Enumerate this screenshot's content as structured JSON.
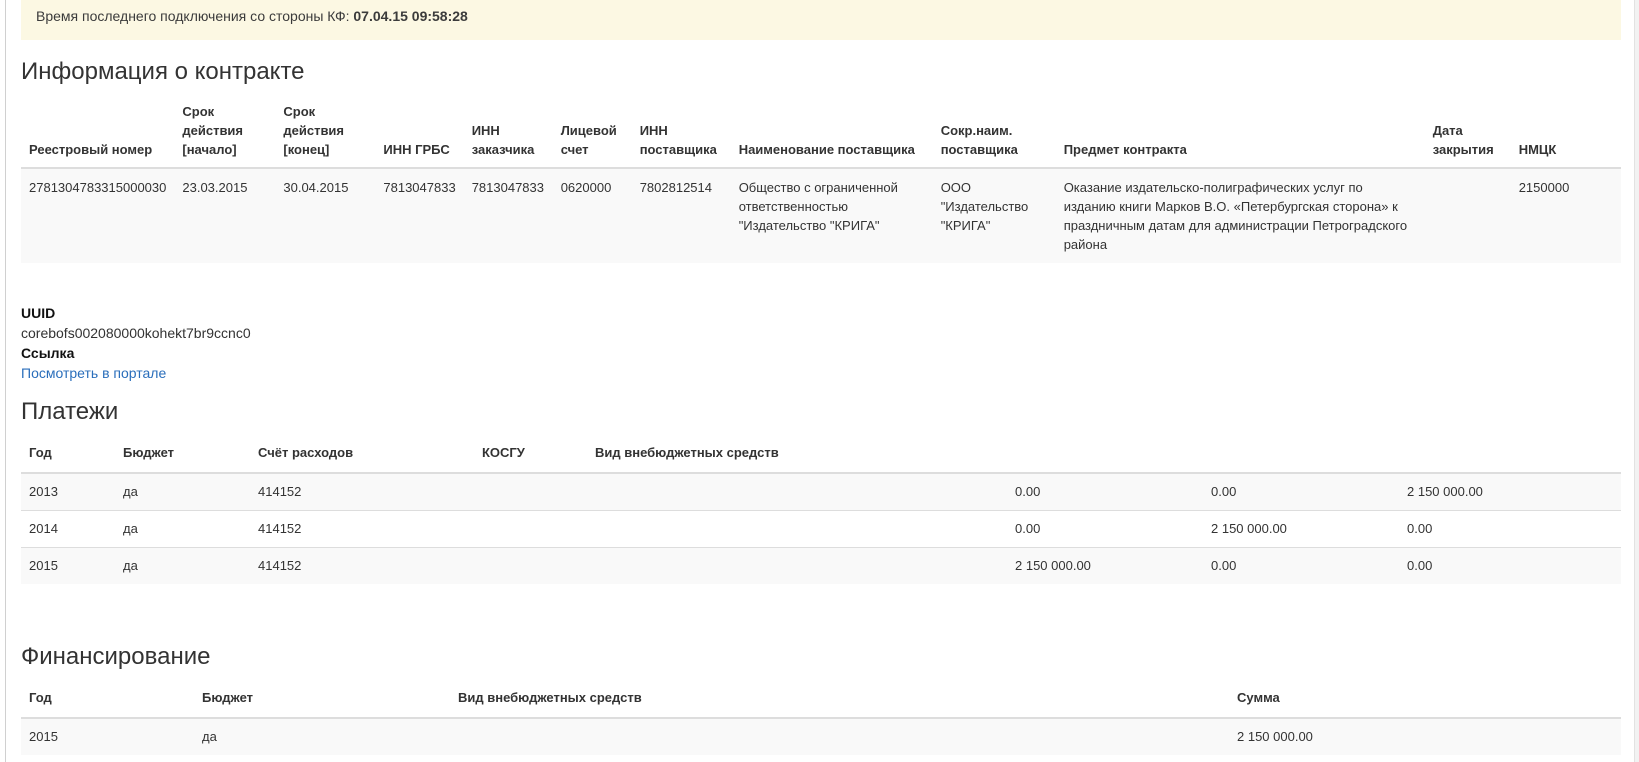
{
  "alert": {
    "label": "Время последнего подключения со стороны КФ:",
    "value": "07.04.15 09:58:28"
  },
  "contract": {
    "title": "Информация о контракте",
    "headers": [
      "Реестровый номер",
      "Срок действия [начало]",
      "Срок действия [конец]",
      "ИНН ГРБС",
      "ИНН заказчика",
      "Лицевой счет",
      "ИНН поставщика",
      "Наименование поставщика",
      "Сокр.наим. поставщика",
      "Предмет контракта",
      "Дата закрытия",
      "НМЦК"
    ],
    "row": {
      "reg_number": "2781304783315000030",
      "start": "23.03.2015",
      "end": "30.04.2015",
      "inn_grbs": "7813047833",
      "inn_customer": "7813047833",
      "account": "0620000",
      "inn_supplier": "7802812514",
      "supplier_name": "Общество с ограниченной ответственностью \"Издательство \"КРИГА\"",
      "supplier_short": "ООО \"Издательство \"КРИГА\"",
      "subject": "Оказание издательско-полиграфических услуг по изданию книги Марков В.О. «Петербургская сторона» к праздничным датам для администрации Петроградского района",
      "close_date": "",
      "nmck": "2150000"
    }
  },
  "info": {
    "uuid_label": "UUID",
    "uuid_value": "corebofs002080000kohekt7br9ccnc0",
    "link_label": "Ссылка",
    "link_text": "Посмотреть в портале"
  },
  "payments": {
    "title": "Платежи",
    "headers": [
      "Год",
      "Бюджет",
      "Счёт расходов",
      "КОСГУ",
      "Вид внебюджетных средств",
      "",
      "",
      ""
    ],
    "rows": [
      {
        "year": "2013",
        "budget": "да",
        "account": "414152",
        "kosgu": "",
        "vid": "",
        "a1": "0.00",
        "a2": "0.00",
        "a3": "2 150 000.00"
      },
      {
        "year": "2014",
        "budget": "да",
        "account": "414152",
        "kosgu": "",
        "vid": "",
        "a1": "0.00",
        "a2": "2 150 000.00",
        "a3": "0.00"
      },
      {
        "year": "2015",
        "budget": "да",
        "account": "414152",
        "kosgu": "",
        "vid": "",
        "a1": "2 150 000.00",
        "a2": "0.00",
        "a3": "0.00"
      }
    ]
  },
  "finance": {
    "title": "Финансирование",
    "headers": [
      "Год",
      "Бюджет",
      "Вид внебюджетных средств",
      "Сумма"
    ],
    "rows": [
      {
        "year": "2015",
        "budget": "да",
        "vid": "",
        "sum": "2 150 000.00"
      }
    ]
  }
}
